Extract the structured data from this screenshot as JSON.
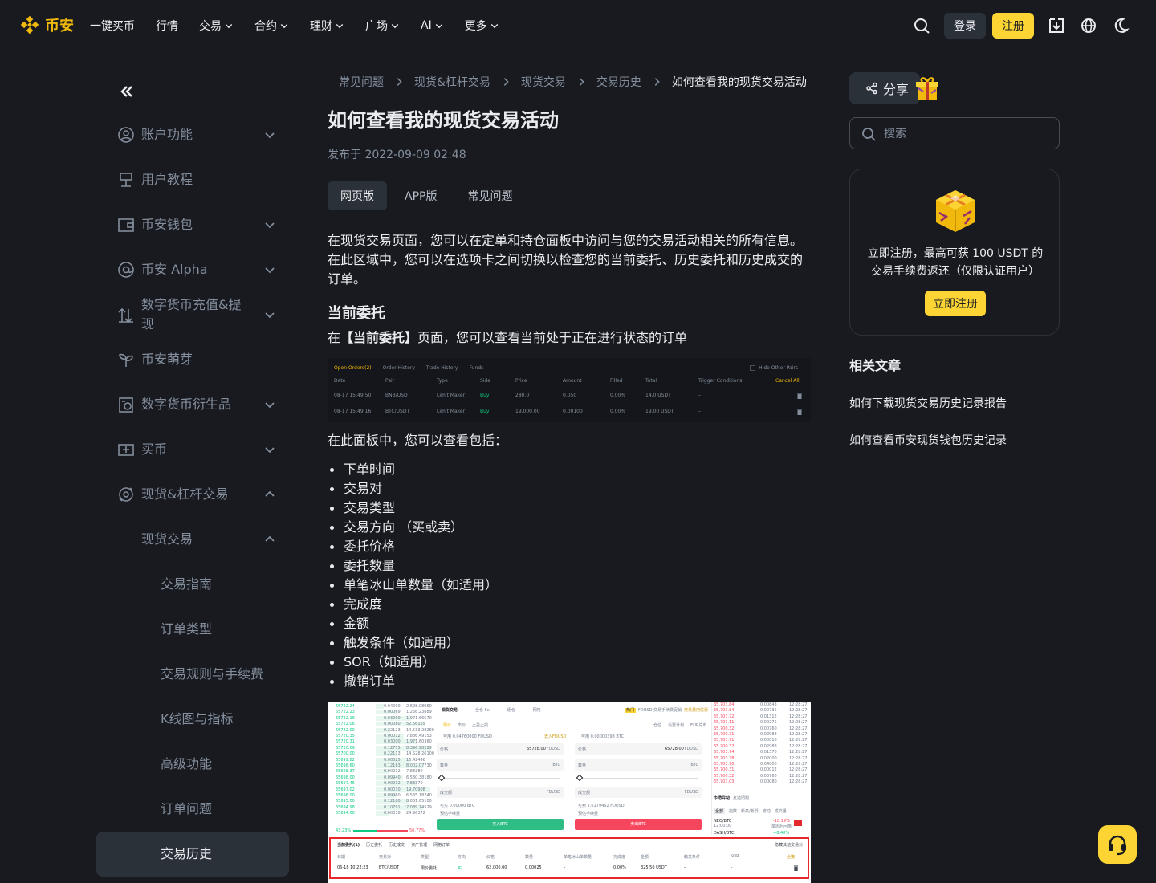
{
  "brand": {
    "name": "币安",
    "color": "#f0b90b"
  },
  "nav": {
    "items": [
      {
        "label": "一键买币",
        "has_dropdown": false
      },
      {
        "label": "行情",
        "has_dropdown": false
      },
      {
        "label": "交易",
        "has_dropdown": true
      },
      {
        "label": "合约",
        "has_dropdown": true
      },
      {
        "label": "理财",
        "has_dropdown": true
      },
      {
        "label": "广场",
        "has_dropdown": true
      },
      {
        "label": "AI",
        "has_dropdown": true
      },
      {
        "label": "更多",
        "has_dropdown": true
      }
    ],
    "login": "登录",
    "register": "注册",
    "icons": [
      "search-icon",
      "download-icon",
      "globe-icon",
      "moon-icon"
    ]
  },
  "sidebar": {
    "items": [
      {
        "label": "账户功能",
        "icon": "user-circle-icon",
        "chevron": "down"
      },
      {
        "label": "用户教程",
        "icon": "book-icon",
        "chevron": ""
      },
      {
        "label": "币安钱包",
        "icon": "wallet-icon",
        "chevron": "down"
      },
      {
        "label": "币安 Alpha",
        "icon": "at-icon",
        "chevron": "down"
      },
      {
        "label": "数字货币充值&提现",
        "icon": "deposit-icon",
        "chevron": "down"
      },
      {
        "label": "币安萌芽",
        "icon": "sprout-icon",
        "chevron": ""
      },
      {
        "label": "数字货币衍生品",
        "icon": "derivatives-icon",
        "chevron": "down"
      },
      {
        "label": "买币",
        "icon": "buy-icon",
        "chevron": "down"
      },
      {
        "label": "现货&杠杆交易",
        "icon": "spot-icon",
        "chevron": "up"
      }
    ],
    "sub": {
      "label": "现货交易",
      "chevron": "up"
    },
    "leaves": [
      "交易指南",
      "订单类型",
      "交易规则与手续费",
      "K线图与指标",
      "高级功能",
      "订单问题",
      "交易历史"
    ],
    "active_leaf": "交易历史"
  },
  "breadcrumb": [
    "常见问题",
    "现货&杠杆交易",
    "现货交易",
    "交易历史",
    "如何查看我的现货交易活动"
  ],
  "article": {
    "title": "如何查看我的现货交易活动",
    "published": "发布于 2022-09-09 02:48",
    "tabs": [
      "网页版",
      "APP版",
      "常见问题"
    ],
    "active_tab": "网页版",
    "intro": "在现货交易页面，您可以在定单和持仓面板中访问与您的交易活动相关的所有信息。在此区域中，您可以在选项卡之间切换以检查您的当前委托、历史委托和历史成交的订单。",
    "section_title": "当前委托",
    "section_pre": "在",
    "section_bold": "【当前委托】",
    "section_post": "页面，您可以查看当前处于正在进行状态的订单",
    "panel_intro": "在此面板中，您可以查看包括：",
    "bullets": [
      "下单时间",
      "交易对",
      "交易类型",
      "交易方向 （买或卖）",
      "委托价格",
      "委托数量",
      "单笔冰山单数量（如适用）",
      "完成度",
      "金额",
      "触发条件（如适用）",
      "SOR（如适用）",
      "撤销订单"
    ]
  },
  "screenshot1": {
    "tabs": [
      "Open Orders(2)",
      "Order History",
      "Trade History",
      "Funds"
    ],
    "hide_pairs": "Hide Other Pairs",
    "headers": [
      "Date",
      "Pair",
      "Type",
      "Side",
      "Price",
      "Amount",
      "Filled",
      "Total",
      "Trigger Conditions",
      "Cancel All"
    ],
    "rows": [
      [
        "08-17 15:49:50",
        "BNB/USDT",
        "Limit Maker",
        "Buy",
        "280.0",
        "0.050",
        "0.00%",
        "14.0 USDT",
        "–"
      ],
      [
        "08-17 15:49:16",
        "BTC/USDT",
        "Limit Maker",
        "Buy",
        "19,000.00",
        "0.00100",
        "0.00%",
        "19.00 USDT",
        "–"
      ]
    ]
  },
  "screenshot2": {
    "orderbook": [
      [
        "65722.24",
        "0.04000",
        "2,628.08960"
      ],
      [
        "65722.23",
        "0.00069",
        "1,266.23889"
      ],
      [
        "65722.19",
        "0.03000",
        "1,971.66570"
      ],
      [
        "65722.06",
        "0.00080",
        "52.56165"
      ],
      [
        "65722.00",
        "0.22123",
        "14,533.28260"
      ],
      [
        "65720.35",
        "0.00012",
        "7,886.49153"
      ],
      [
        "65720.31",
        "0.03000",
        "1,971.60360"
      ],
      [
        "65720.09",
        "0.12775",
        "8,396.98229"
      ],
      [
        "65700.00",
        "0.22113",
        "14,528.26100"
      ],
      [
        "65699.82",
        "0.00025",
        "16.42496"
      ],
      [
        "65698.60",
        "0.12183",
        "8,002.07730"
      ],
      [
        "65698.37",
        "0.00012",
        "7.88380"
      ],
      [
        "65698.00",
        "0.09940",
        "6,530.38180"
      ],
      [
        "65697.46",
        "0.00012",
        "7.88370"
      ],
      [
        "65697.02",
        "0.00030",
        "19.70908"
      ],
      [
        "65696.00",
        "0.09960",
        "6,535.18240"
      ],
      [
        "65695.00",
        "0.12180",
        "8,001.65100"
      ],
      [
        "65694.98",
        "0.10791",
        "7,089.14529"
      ],
      [
        "65694.00",
        "0.00038",
        "24.96372"
      ]
    ],
    "ob_footer": [
      "43.23%",
      "56.77%"
    ],
    "trade_tabs": [
      "现货交易",
      "全仓 5x",
      "逐仓",
      "网格"
    ],
    "trade_sub": [
      "限价",
      "市价",
      "止盈止损"
    ],
    "promo_tag": "热门",
    "promo_text": "FDUSD 交易手续费促销",
    "promo_link": "交易费用优惠",
    "avail_buy": "可用 0.04760000 FDUSD",
    "avail_buy_link": "去入FDUSD",
    "avail_sell": "可用 0.00000393 BTC",
    "right_tabs": [
      "仓位",
      "设置计划",
      "EUR兑币"
    ],
    "field_price": "价格",
    "field_price_val": "65728.00",
    "quote_unit": "FDUSD",
    "field_amount": "数量",
    "base_unit": "BTC",
    "field_total": "成交额",
    "est_buy": "可买 0.00000 BTC",
    "est_sell": "可卖 2.6179462 FDUSD",
    "fee_buy": "预估手续费",
    "fee_sell": "预估手续费",
    "buy_btn": "买入BTC",
    "sell_btn": "卖出BTC",
    "trades": [
      [
        "65,703.84",
        "0.00843",
        "12:28:27"
      ],
      [
        "65,703.84",
        "0.00735",
        "12:28:27"
      ],
      [
        "65,703.72",
        "0.01312",
        "12:28:27"
      ],
      [
        "65,703.11",
        "0.00275",
        "12:28:27"
      ],
      [
        "65,700.32",
        "0.00760",
        "12:28:27"
      ],
      [
        "65,700.31",
        "0.02988",
        "12:28:27"
      ],
      [
        "65,703.71",
        "0.00018",
        "12:28:27"
      ],
      [
        "65,700.32",
        "0.02988",
        "12:28:27"
      ],
      [
        "65,703.74",
        "0.01370",
        "12:28:27"
      ],
      [
        "65,703.78",
        "0.02000",
        "12:28:27"
      ],
      [
        "65,703.70",
        "0.04000",
        "12:28:27"
      ],
      [
        "65,700.31",
        "0.00012",
        "12:28:27"
      ],
      [
        "65,700.32",
        "0.00760",
        "12:28:27"
      ],
      [
        "65,703.03",
        "0.00080",
        "12:28:27"
      ]
    ],
    "market_title": "市场异动",
    "market_link": "复选问题",
    "market_tabs": [
      "全部",
      "指数",
      "新高/新低",
      "波动",
      "成交量"
    ],
    "market_pair": "NEO/BTC",
    "market_time": "12:00:00",
    "market_change": "-18.19%",
    "market_label": "单周后回落",
    "market_pair2": "DASH/BTC",
    "market_change2": "+8.48%",
    "bottom_tabs": [
      "当前委托(1)",
      "历史委托",
      "历史成交",
      "资产管理",
      "网格订单"
    ],
    "bottom_hide": "隐藏其他交易对",
    "bottom_headers": [
      "日期",
      "交易对",
      "类型",
      "方向",
      "价格",
      "数量",
      "单笔冰山单数量",
      "完成度",
      "金额",
      "触发条件",
      "SOR",
      "全撤"
    ],
    "bottom_row": [
      "06-18 10:22:23",
      "BTC/USDT",
      "限价委托",
      "买",
      "62,000.00",
      "0.00025",
      "–",
      "0.00%",
      "325.50 USDT",
      "–",
      "–"
    ]
  },
  "right": {
    "share": "分享",
    "search_placeholder": "搜索",
    "promo_text": "立即注册，最高可获 100 USDT 的交易手续费返还（仅限认证用户）",
    "promo_btn": "立即注册",
    "related_title": "相关文章",
    "related": [
      "如何下载现货交易历史记录报告",
      "如何查看币安现货钱包历史记录"
    ]
  },
  "colors": {
    "bg": "#181a20",
    "accent": "#fcd535",
    "text": "#eaecef",
    "muted": "#848e9c",
    "panel": "#2b3139"
  }
}
